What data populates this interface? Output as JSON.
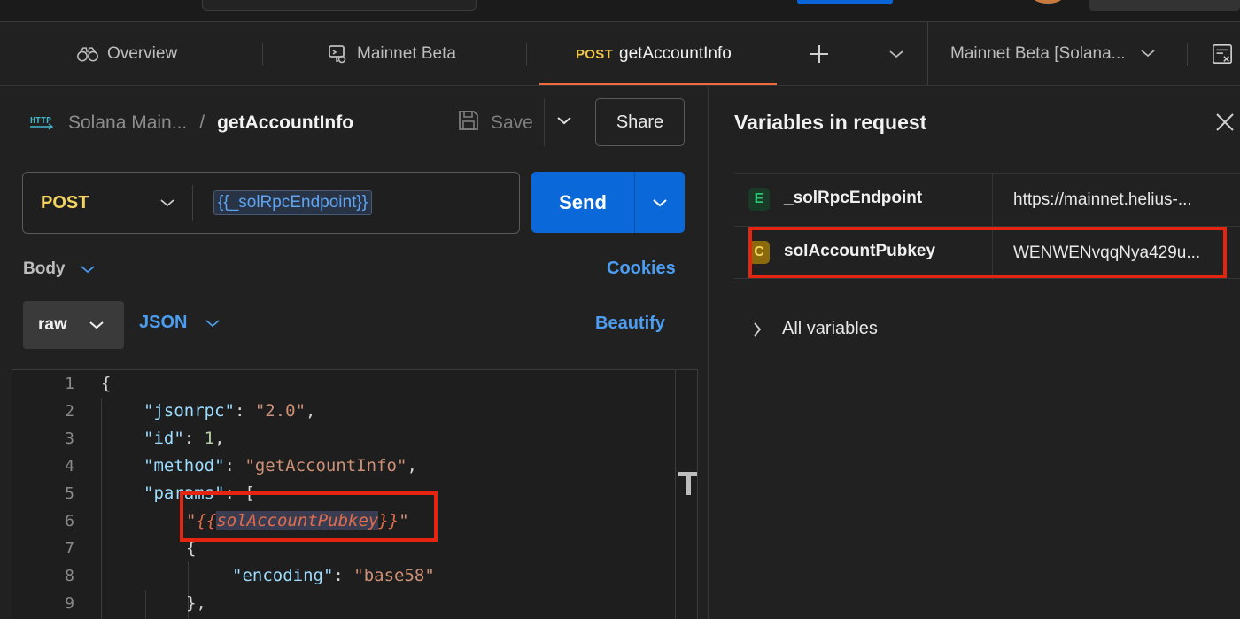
{
  "tabs": {
    "overview": "Overview",
    "mainnet": "Mainnet Beta",
    "active_method": "POST",
    "active_name": "getAccountInfo",
    "environment": "Mainnet Beta [Solana..."
  },
  "request": {
    "breadcrumb_collection": "Solana Main...",
    "breadcrumb_sep": "/",
    "title": "getAccountInfo",
    "save_label": "Save",
    "share_label": "Share",
    "method": "POST",
    "url_variable": "{{_solRpcEndpoint}}",
    "send_label": "Send",
    "body_label": "Body",
    "cookies_label": "Cookies",
    "body_mode": "raw",
    "body_format": "JSON",
    "beautify_label": "Beautify"
  },
  "editor": {
    "line_numbers": [
      "1",
      "2",
      "3",
      "4",
      "5",
      "6",
      "7",
      "8",
      "9"
    ],
    "open_brace": "{",
    "jsonrpc_key": "\"jsonrpc\"",
    "jsonrpc_val": "\"2.0\"",
    "id_key": "\"id\"",
    "id_val": "1",
    "method_key": "\"method\"",
    "method_val": "\"getAccountInfo\"",
    "params_key": "\"params\"",
    "params_open": "[",
    "param_quote": "\"",
    "param_var_open": "{{",
    "param_var": "solAccountPubkey",
    "param_var_close": "}}",
    "obj_open": "{",
    "encoding_key": "\"encoding\"",
    "encoding_val": "\"base58\"",
    "obj_close": "},",
    "colon": ": ",
    "comma": ","
  },
  "variables_panel": {
    "title": "Variables in request",
    "rows": [
      {
        "badge": "E",
        "badge_color": "#2fbf71",
        "badge_bg": "#183a27",
        "name": "_solRpcEndpoint",
        "value": "https://mainnet.helius-..."
      },
      {
        "badge": "C",
        "badge_color": "#f7d25c",
        "badge_bg": "#8a6a0c",
        "name": "solAccountPubkey",
        "value": "WENWENvqqNya429u..."
      }
    ],
    "all_variables_label": "All variables"
  },
  "colors": {
    "accent": "#0a68d9",
    "tab_underline": "#f06a3e",
    "highlight_box": "#e5250f",
    "link": "#4c9df0"
  }
}
